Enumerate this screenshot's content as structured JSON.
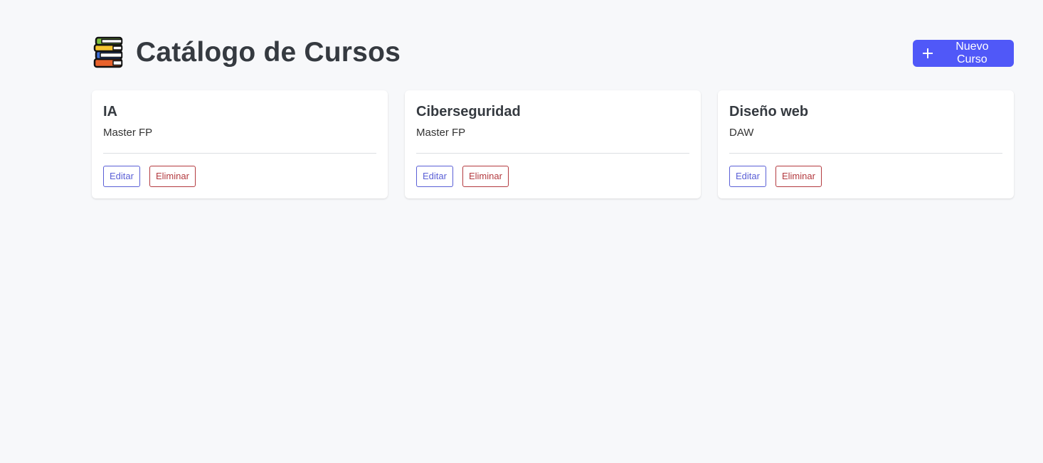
{
  "header": {
    "icon": "books-icon",
    "title": "Catálogo de Cursos",
    "new_button": {
      "icon": "plus-icon",
      "label": "Nuevo Curso"
    }
  },
  "colors": {
    "accent": "#5058f8",
    "edit": "#5a5fd6",
    "delete": "#b33a3f",
    "background": "#f7f8fa"
  },
  "courses": [
    {
      "title": "IA",
      "subtitle": "Master FP",
      "edit_label": "Editar",
      "delete_label": "Eliminar"
    },
    {
      "title": "Ciberseguridad",
      "subtitle": "Master FP",
      "edit_label": "Editar",
      "delete_label": "Eliminar"
    },
    {
      "title": "Diseño web",
      "subtitle": "DAW",
      "edit_label": "Editar",
      "delete_label": "Eliminar"
    }
  ]
}
